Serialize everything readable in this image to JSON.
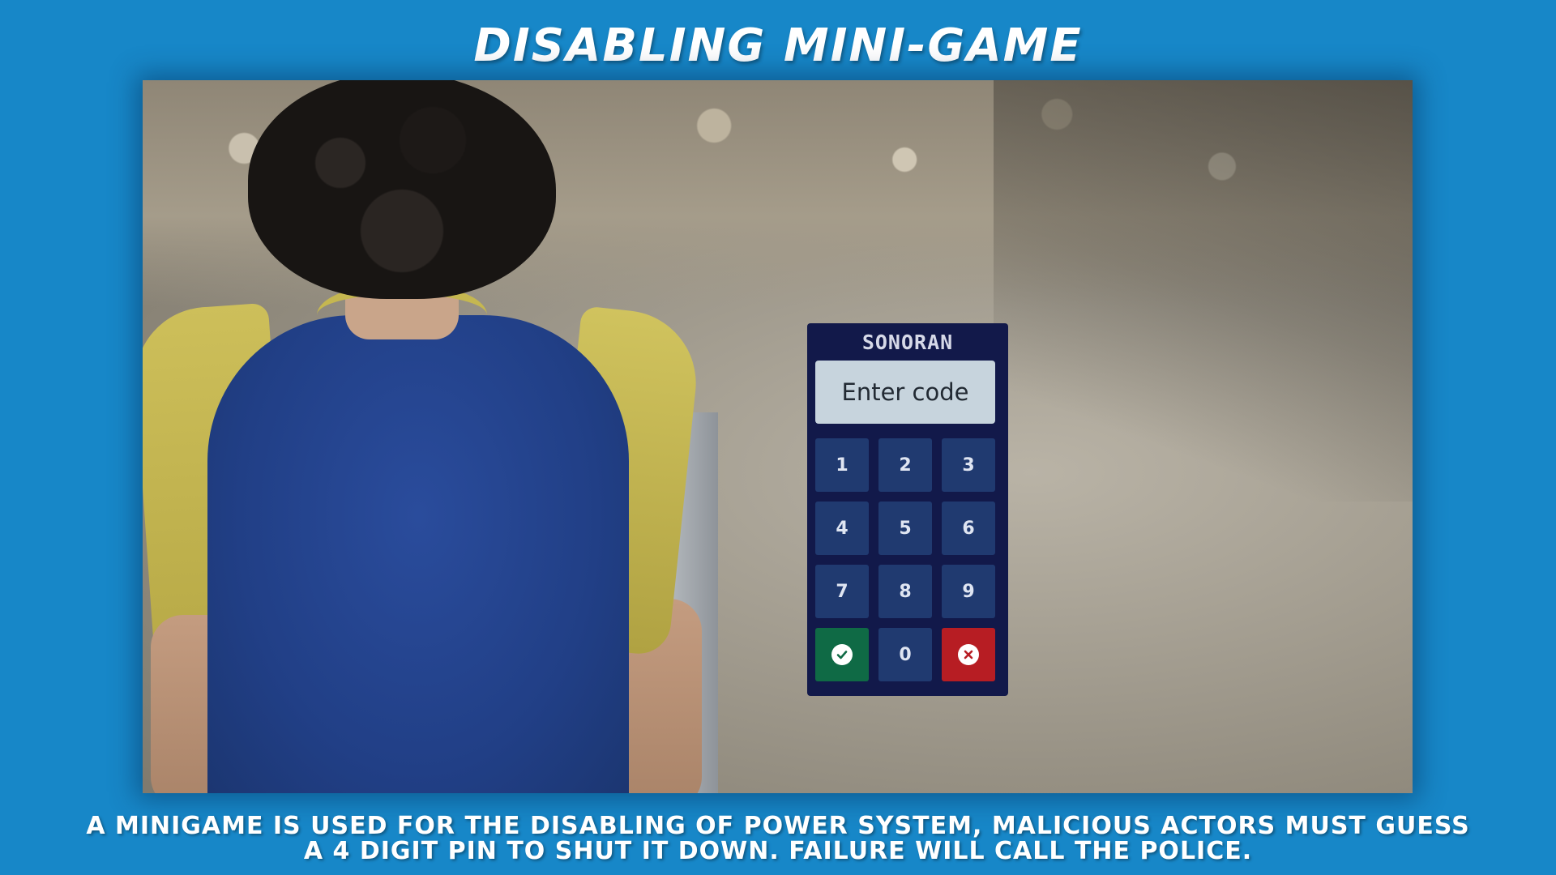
{
  "header": {
    "title": "DISABLING MINI-GAME"
  },
  "keypad": {
    "brand": "SONORAN",
    "code_placeholder": "Enter code",
    "keys": [
      "1",
      "2",
      "3",
      "4",
      "5",
      "6",
      "7",
      "8",
      "9"
    ],
    "zero": "0",
    "confirm_icon": "check-circle-icon",
    "cancel_icon": "x-circle-icon",
    "colors": {
      "panel": "#12194a",
      "key": "#203a70",
      "confirm": "#0f6a45",
      "cancel": "#b71d23",
      "display": "#c7d4dd"
    }
  },
  "caption": {
    "line1": "A MINIGAME IS USED FOR THE DISABLING OF POWER SYSTEM, MALICIOUS ACTORS MUST GUESS",
    "line2": "A 4 DIGIT PIN TO SHUT IT DOWN. FAILURE WILL CALL THE POLICE."
  },
  "theme": {
    "background": "#1787c8"
  }
}
